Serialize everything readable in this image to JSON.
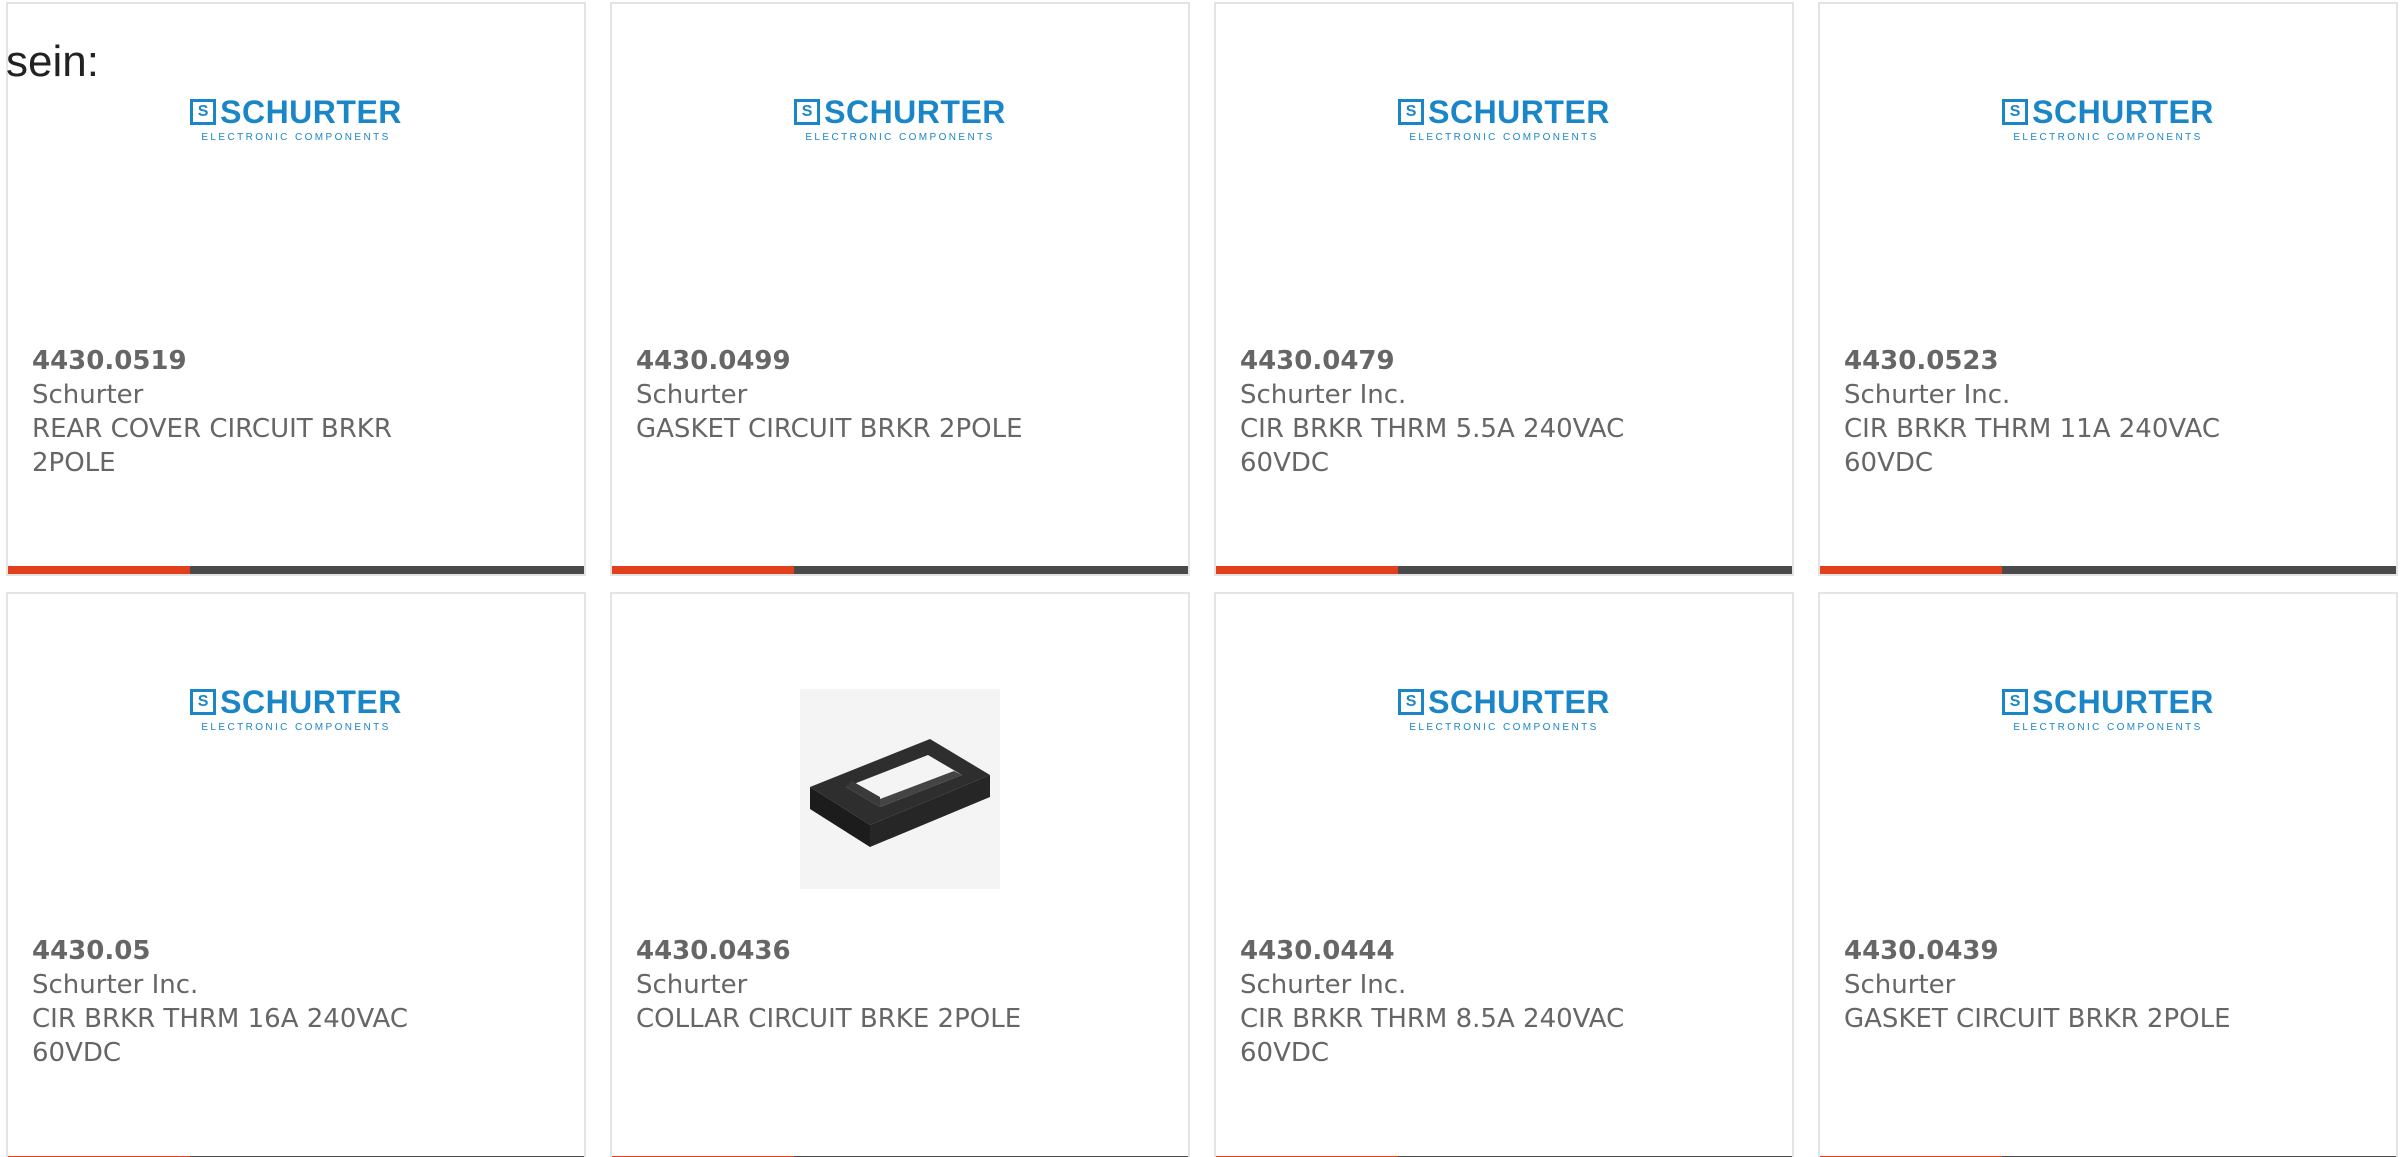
{
  "intro": {
    "text": "sein:"
  },
  "colors": {
    "accent": "#e2401c",
    "bar": "#4a4a4a",
    "brand": "#1a86c8",
    "text": "#666666"
  },
  "logo": {
    "mark": "S",
    "word": "SCHURTER",
    "subtitle": "ELECTRONIC COMPONENTS"
  },
  "products": [
    {
      "part": "4430.0519",
      "brand": "Schurter",
      "description": "REAR COVER CIRCUIT BRKR 2POLE",
      "image": "schurter-logo"
    },
    {
      "part": "4430.0499",
      "brand": "Schurter",
      "description": "GASKET CIRCUIT BRKR 2POLE",
      "image": "schurter-logo"
    },
    {
      "part": "4430.0479",
      "brand": "Schurter Inc.",
      "description": "CIR BRKR THRM 5.5A 240VAC 60VDC",
      "image": "schurter-logo"
    },
    {
      "part": "4430.0523",
      "brand": "Schurter Inc.",
      "description": "CIR BRKR THRM 11A 240VAC 60VDC",
      "image": "schurter-logo"
    },
    {
      "part": "4430.05",
      "brand": "Schurter Inc.",
      "description": "CIR BRKR THRM 16A 240VAC 60VDC",
      "image": "schurter-logo"
    },
    {
      "part": "4430.0436",
      "brand": "Schurter",
      "description": "COLLAR CIRCUIT BRKE 2POLE",
      "image": "collar-photo"
    },
    {
      "part": "4430.0444",
      "brand": "Schurter Inc.",
      "description": "CIR BRKR THRM 8.5A 240VAC 60VDC",
      "image": "schurter-logo"
    },
    {
      "part": "4430.0439",
      "brand": "Schurter",
      "description": "GASKET CIRCUIT BRKR 2POLE",
      "image": "schurter-logo"
    }
  ]
}
